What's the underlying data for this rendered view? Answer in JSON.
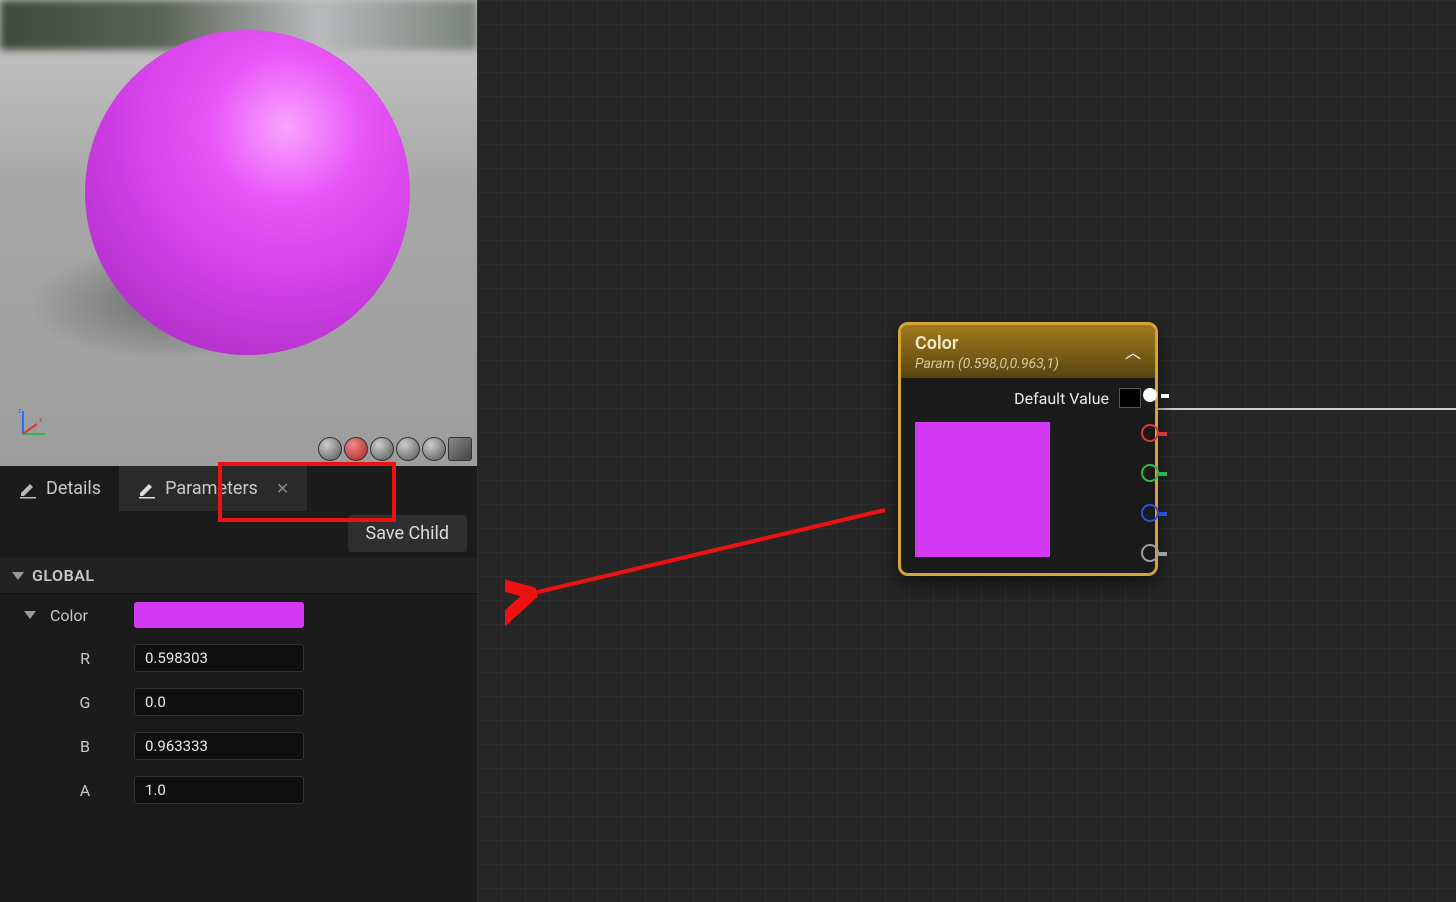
{
  "tabs": {
    "details_label": "Details",
    "parameters_label": "Parameters"
  },
  "buttons": {
    "save_child": "Save Child"
  },
  "param_group": {
    "global_label": "GLOBAL",
    "color_label": "Color",
    "color_hex": "#d43af5",
    "channels": [
      {
        "label": "R",
        "value": "0.598303"
      },
      {
        "label": "G",
        "value": "0.0"
      },
      {
        "label": "B",
        "value": "0.963333"
      },
      {
        "label": "A",
        "value": "1.0"
      }
    ]
  },
  "node": {
    "title": "Color",
    "subtitle": "Param (0.598,0,0.963,1)",
    "default_value_label": "Default Value",
    "default_swatch": "#000000",
    "preview_swatch": "#d43af5"
  },
  "viewport": {
    "sphere_color": "#d43af5"
  },
  "annotations": {
    "highlight_tab": "parameters",
    "arrow": true
  }
}
